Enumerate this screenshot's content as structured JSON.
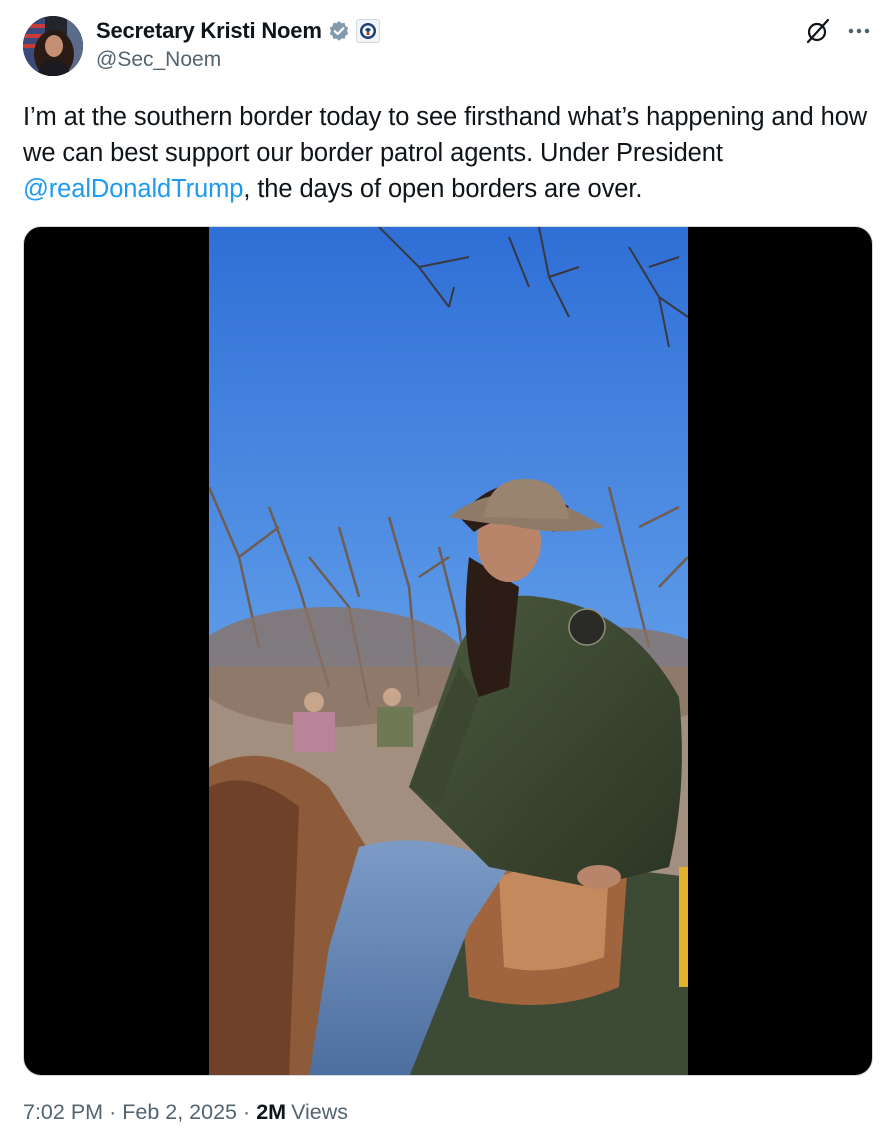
{
  "author": {
    "display_name": "Secretary Kristi Noem",
    "handle": "@Sec_Noem",
    "verified_badge_icon": "verified-badge-icon",
    "affiliation_icon": "dhs-seal-icon",
    "verified_color": "#829aab"
  },
  "post": {
    "text_before": "I’m at the southern border today to see firsthand what’s happening and how we can best support our border patrol agents. Under President ",
    "mention": "@realDonaldTrump",
    "text_after": ", the days of open borders are over.",
    "mention_color": "#1d9bf0"
  },
  "actions": {
    "grok_icon": "grok-icon",
    "more_icon": "more-options-icon"
  },
  "meta": {
    "time": "7:02 PM",
    "separator": "·",
    "date": "Feb 2, 2025",
    "views_count": "2M",
    "views_label": "Views"
  }
}
